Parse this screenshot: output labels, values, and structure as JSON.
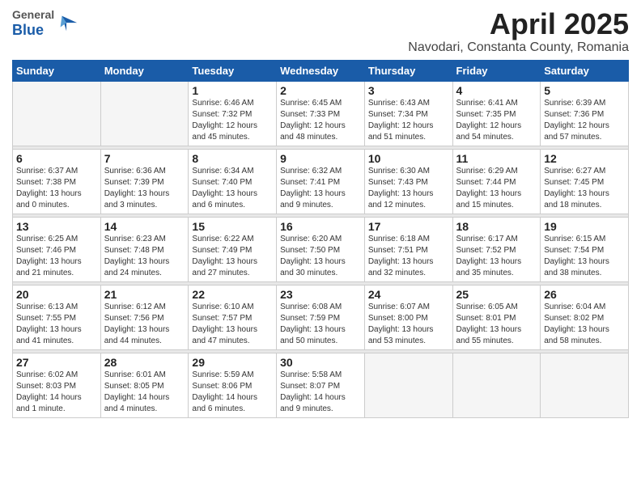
{
  "logo": {
    "general": "General",
    "blue": "Blue"
  },
  "title": "April 2025",
  "location": "Navodari, Constanta County, Romania",
  "days_header": [
    "Sunday",
    "Monday",
    "Tuesday",
    "Wednesday",
    "Thursday",
    "Friday",
    "Saturday"
  ],
  "weeks": [
    [
      {
        "day": "",
        "info": ""
      },
      {
        "day": "",
        "info": ""
      },
      {
        "day": "1",
        "info": "Sunrise: 6:46 AM\nSunset: 7:32 PM\nDaylight: 12 hours and 45 minutes."
      },
      {
        "day": "2",
        "info": "Sunrise: 6:45 AM\nSunset: 7:33 PM\nDaylight: 12 hours and 48 minutes."
      },
      {
        "day": "3",
        "info": "Sunrise: 6:43 AM\nSunset: 7:34 PM\nDaylight: 12 hours and 51 minutes."
      },
      {
        "day": "4",
        "info": "Sunrise: 6:41 AM\nSunset: 7:35 PM\nDaylight: 12 hours and 54 minutes."
      },
      {
        "day": "5",
        "info": "Sunrise: 6:39 AM\nSunset: 7:36 PM\nDaylight: 12 hours and 57 minutes."
      }
    ],
    [
      {
        "day": "6",
        "info": "Sunrise: 6:37 AM\nSunset: 7:38 PM\nDaylight: 13 hours and 0 minutes."
      },
      {
        "day": "7",
        "info": "Sunrise: 6:36 AM\nSunset: 7:39 PM\nDaylight: 13 hours and 3 minutes."
      },
      {
        "day": "8",
        "info": "Sunrise: 6:34 AM\nSunset: 7:40 PM\nDaylight: 13 hours and 6 minutes."
      },
      {
        "day": "9",
        "info": "Sunrise: 6:32 AM\nSunset: 7:41 PM\nDaylight: 13 hours and 9 minutes."
      },
      {
        "day": "10",
        "info": "Sunrise: 6:30 AM\nSunset: 7:43 PM\nDaylight: 13 hours and 12 minutes."
      },
      {
        "day": "11",
        "info": "Sunrise: 6:29 AM\nSunset: 7:44 PM\nDaylight: 13 hours and 15 minutes."
      },
      {
        "day": "12",
        "info": "Sunrise: 6:27 AM\nSunset: 7:45 PM\nDaylight: 13 hours and 18 minutes."
      }
    ],
    [
      {
        "day": "13",
        "info": "Sunrise: 6:25 AM\nSunset: 7:46 PM\nDaylight: 13 hours and 21 minutes."
      },
      {
        "day": "14",
        "info": "Sunrise: 6:23 AM\nSunset: 7:48 PM\nDaylight: 13 hours and 24 minutes."
      },
      {
        "day": "15",
        "info": "Sunrise: 6:22 AM\nSunset: 7:49 PM\nDaylight: 13 hours and 27 minutes."
      },
      {
        "day": "16",
        "info": "Sunrise: 6:20 AM\nSunset: 7:50 PM\nDaylight: 13 hours and 30 minutes."
      },
      {
        "day": "17",
        "info": "Sunrise: 6:18 AM\nSunset: 7:51 PM\nDaylight: 13 hours and 32 minutes."
      },
      {
        "day": "18",
        "info": "Sunrise: 6:17 AM\nSunset: 7:52 PM\nDaylight: 13 hours and 35 minutes."
      },
      {
        "day": "19",
        "info": "Sunrise: 6:15 AM\nSunset: 7:54 PM\nDaylight: 13 hours and 38 minutes."
      }
    ],
    [
      {
        "day": "20",
        "info": "Sunrise: 6:13 AM\nSunset: 7:55 PM\nDaylight: 13 hours and 41 minutes."
      },
      {
        "day": "21",
        "info": "Sunrise: 6:12 AM\nSunset: 7:56 PM\nDaylight: 13 hours and 44 minutes."
      },
      {
        "day": "22",
        "info": "Sunrise: 6:10 AM\nSunset: 7:57 PM\nDaylight: 13 hours and 47 minutes."
      },
      {
        "day": "23",
        "info": "Sunrise: 6:08 AM\nSunset: 7:59 PM\nDaylight: 13 hours and 50 minutes."
      },
      {
        "day": "24",
        "info": "Sunrise: 6:07 AM\nSunset: 8:00 PM\nDaylight: 13 hours and 53 minutes."
      },
      {
        "day": "25",
        "info": "Sunrise: 6:05 AM\nSunset: 8:01 PM\nDaylight: 13 hours and 55 minutes."
      },
      {
        "day": "26",
        "info": "Sunrise: 6:04 AM\nSunset: 8:02 PM\nDaylight: 13 hours and 58 minutes."
      }
    ],
    [
      {
        "day": "27",
        "info": "Sunrise: 6:02 AM\nSunset: 8:03 PM\nDaylight: 14 hours and 1 minute."
      },
      {
        "day": "28",
        "info": "Sunrise: 6:01 AM\nSunset: 8:05 PM\nDaylight: 14 hours and 4 minutes."
      },
      {
        "day": "29",
        "info": "Sunrise: 5:59 AM\nSunset: 8:06 PM\nDaylight: 14 hours and 6 minutes."
      },
      {
        "day": "30",
        "info": "Sunrise: 5:58 AM\nSunset: 8:07 PM\nDaylight: 14 hours and 9 minutes."
      },
      {
        "day": "",
        "info": ""
      },
      {
        "day": "",
        "info": ""
      },
      {
        "day": "",
        "info": ""
      }
    ]
  ]
}
